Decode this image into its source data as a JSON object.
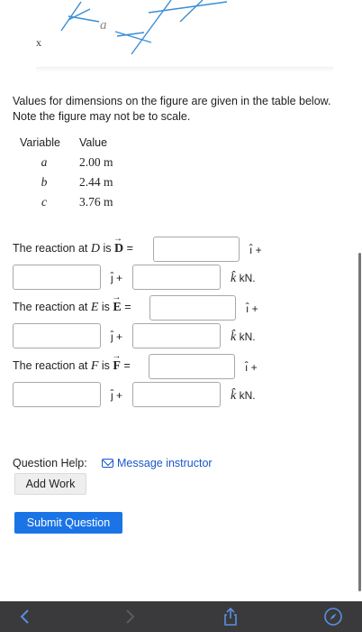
{
  "figure": {
    "x_label": "x",
    "a_label": "a"
  },
  "intro_text": "Values for dimensions on the figure are given in the table below. Note the figure may not be to scale.",
  "table": {
    "headers": [
      "Variable",
      "Value"
    ],
    "rows": [
      {
        "var": "a",
        "value": "2.00 m"
      },
      {
        "var": "b",
        "value": "2.44 m"
      },
      {
        "var": "c",
        "value": "3.76 m"
      }
    ]
  },
  "questions": [
    {
      "prefix": "The reaction at ",
      "point": "D",
      "mid": " is ",
      "vector": "D",
      "eq": " =",
      "i_unit": "ı̂ +",
      "j_unit": "ȷ̂ +",
      "k_unit": "k̂",
      "unit": "kN."
    },
    {
      "prefix": "The reaction at ",
      "point": "E",
      "mid": " is ",
      "vector": "E",
      "eq": " =",
      "i_unit": "ı̂ +",
      "j_unit": "ȷ̂ +",
      "k_unit": "k̂",
      "unit": "kN."
    },
    {
      "prefix": "The reaction at ",
      "point": "F",
      "mid": " is ",
      "vector": "F",
      "eq": " =",
      "i_unit": "ı̂ +",
      "j_unit": "ȷ̂ +",
      "k_unit": "k̂",
      "unit": "kN."
    }
  ],
  "help": {
    "label": "Question Help:",
    "message_link": "Message instructor",
    "add_work": "Add Work"
  },
  "submit_label": "Submit Question",
  "colors": {
    "accent": "#1b74e6",
    "link": "#1a56c9",
    "toolbar": "#3a3a3c",
    "figure_lines": "#3b8ed4"
  },
  "toolbar_icons": [
    "back-icon",
    "forward-icon",
    "share-icon",
    "compass-icon"
  ]
}
